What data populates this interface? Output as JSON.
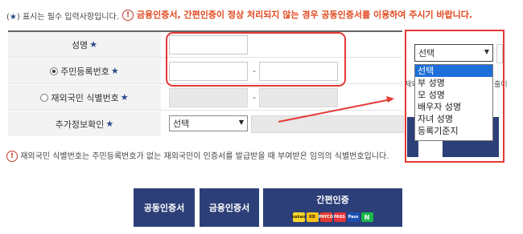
{
  "notice": {
    "required_prefix": "(",
    "required_star": "★",
    "required_suffix": ") 표시는 필수 입력사항입니다.",
    "warning": "금융인증서, 간편인증이 정상 처리되지 않는 경우 공동인증서를 이용하여 주시기 바랍니다."
  },
  "form": {
    "rows": [
      {
        "label": "성명",
        "req": "★"
      },
      {
        "label": "주민등록번호",
        "req": "★"
      },
      {
        "label": "재외국민 식별번호",
        "req": "★"
      },
      {
        "label": "추가정보확인",
        "req": "★"
      }
    ],
    "dash": "-",
    "additional_select_value": "선택"
  },
  "dropdown": {
    "selected": "선택",
    "options": [
      "선택",
      "부 성명",
      "모 성명",
      "배우자 성명",
      "자녀 성명",
      "등록기준지"
    ]
  },
  "behind": {
    "left_text": "재외",
    "right_text": "출이"
  },
  "footnote": "재외국민 식별번호는 주민등록번호가 없는 재외국민이 인증서를 발급받을 때 부여받은 임의의 식별번호입니다.",
  "buttons": {
    "joint": "공동인증서",
    "financial": "금융인증서",
    "easy": "간편인증"
  },
  "easy_icons": [
    {
      "name": "kakao-icon",
      "label": "kakao",
      "color": "#f7d82f"
    },
    {
      "name": "kb-icon",
      "label": "KB",
      "color": "#f5c118"
    },
    {
      "name": "payco-icon",
      "label": "PAYCO",
      "color": "#e23a2f"
    },
    {
      "name": "pass-icon",
      "label": "PASS",
      "color": "#e5333b"
    },
    {
      "name": "samsung-pass-icon",
      "label": "Pass",
      "color": "#1b4fb5"
    },
    {
      "name": "naver-icon",
      "label": "N",
      "color": "#19b84a"
    }
  ],
  "colors": {
    "accent": "#2c3f78",
    "warning": "#e0471e",
    "highlight": "#e53935"
  }
}
